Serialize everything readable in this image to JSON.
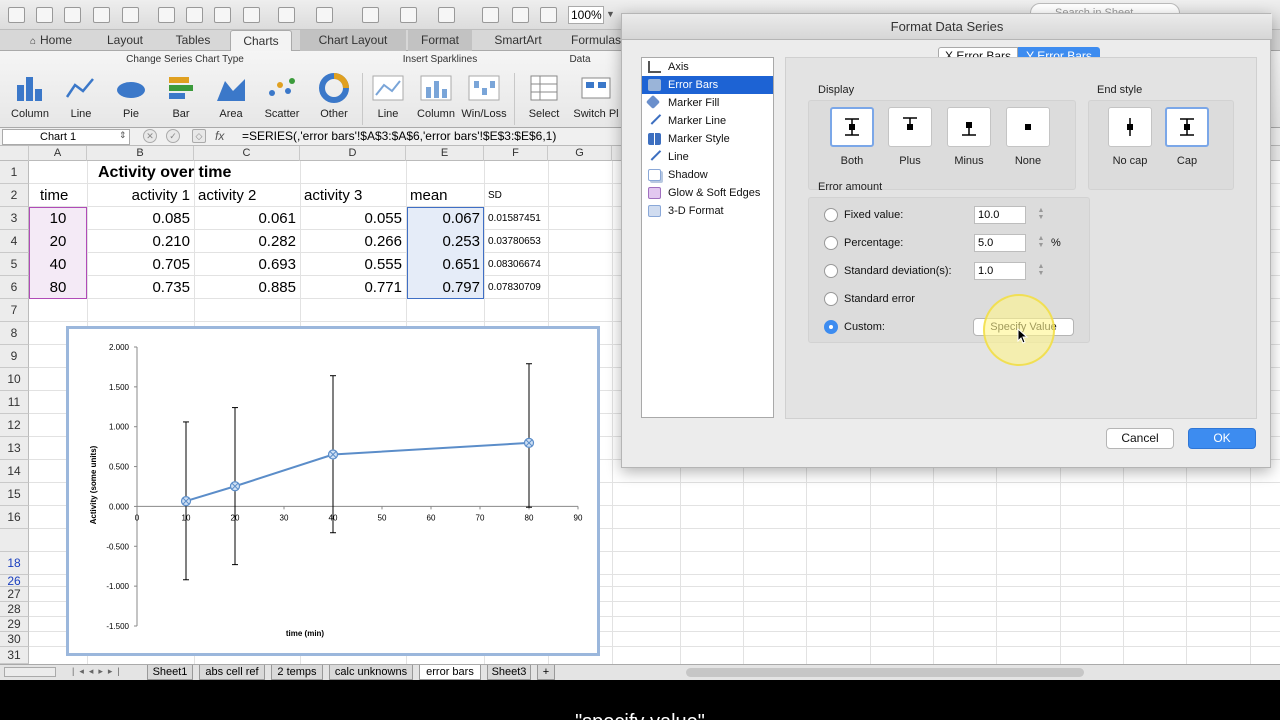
{
  "toolbar": {
    "zoom": "100%",
    "search_placeholder": "Search in Sheet"
  },
  "ribbon_tabs": [
    "Home",
    "Layout",
    "Tables",
    "Charts",
    "Chart Layout",
    "Format",
    "SmartArt",
    "Formulas"
  ],
  "ribbon": {
    "group_change_type": "Change Series Chart Type",
    "group_sparklines": "Insert Sparklines",
    "group_data": "Data",
    "buttons": [
      "Column",
      "Line",
      "Pie",
      "Bar",
      "Area",
      "Scatter",
      "Other",
      "Line",
      "Column",
      "Win/Loss",
      "Select",
      "Switch Pl"
    ]
  },
  "formula_bar": {
    "name_box": "Chart 1",
    "fx": "fx",
    "formula": "=SERIES(,'error bars'!$A$3:$A$6,'error bars'!$E$3:$E$6,1)"
  },
  "columns": [
    "A",
    "B",
    "C",
    "D",
    "E",
    "F",
    "G"
  ],
  "rows": [
    "1",
    "2",
    "3",
    "4",
    "5",
    "6",
    "7",
    "8",
    "9",
    "10",
    "11",
    "12",
    "13",
    "14",
    "15",
    "16",
    "18",
    "26",
    "27",
    "28",
    "29",
    "30",
    "31"
  ],
  "sheet": {
    "title": "Activity over time",
    "headers": [
      "time",
      "activity 1",
      "activity 2",
      "activity 3",
      "mean",
      "SD"
    ],
    "data": [
      [
        "10",
        "0.085",
        "0.061",
        "0.055",
        "0.067",
        "0.01587451"
      ],
      [
        "20",
        "0.210",
        "0.282",
        "0.266",
        "0.253",
        "0.03780653"
      ],
      [
        "40",
        "0.705",
        "0.693",
        "0.555",
        "0.651",
        "0.08306674"
      ],
      [
        "80",
        "0.735",
        "0.885",
        "0.771",
        "0.797",
        "0.07830709"
      ]
    ]
  },
  "chart_data": {
    "type": "line",
    "x": [
      10,
      20,
      40,
      80
    ],
    "series": [
      {
        "values": [
          0.067,
          0.253,
          0.651,
          0.797
        ],
        "err_low": [
          -0.92,
          -0.73,
          -0.33,
          -0.01
        ],
        "err_high": [
          1.06,
          1.24,
          1.64,
          1.79
        ]
      }
    ],
    "xlabel": "time (min)",
    "ylabel": "Activity (some units)",
    "xlim": [
      0,
      90
    ],
    "ylim": [
      -1.5,
      2.0
    ],
    "x_ticks": [
      "0",
      "10",
      "20",
      "30",
      "40",
      "50",
      "60",
      "70",
      "80",
      "90"
    ],
    "y_ticks": [
      "2.000",
      "1.500",
      "1.000",
      "0.500",
      "0.000",
      "-0.500",
      "-1.000",
      "-1.500"
    ],
    "line_color": "#5b8dc9",
    "errbar_color": "#000000"
  },
  "sheet_tabs": [
    "Sheet1",
    "abs cell ref",
    "2 temps",
    "calc unknowns",
    "error bars",
    "Sheet3",
    "+"
  ],
  "active_sheet": "error bars",
  "dialog": {
    "title": "Format Data Series",
    "categories": [
      "Axis",
      "Error Bars",
      "Marker Fill",
      "Marker Line",
      "Marker Style",
      "Line",
      "Shadow",
      "Glow & Soft Edges",
      "3-D Format"
    ],
    "selected_category": "Error Bars",
    "tabs": [
      "X Error Bars",
      "Y Error Bars"
    ],
    "active_tab": "Y Error Bars",
    "display_label": "Display",
    "display_options": [
      "Both",
      "Plus",
      "Minus",
      "None"
    ],
    "end_style_label": "End style",
    "end_style_options": [
      "No cap",
      "Cap"
    ],
    "error_amount_label": "Error amount",
    "fixed_label": "Fixed value:",
    "fixed_value": "10.0",
    "percentage_label": "Percentage:",
    "percentage_value": "5.0",
    "percent_sign": "%",
    "stdev_label": "Standard deviation(s):",
    "stdev_value": "1.0",
    "stderr_label": "Standard error",
    "custom_label": "Custom:",
    "specify_button": "Specify Value",
    "cancel": "Cancel",
    "ok": "OK"
  },
  "caption": "\"specify value\""
}
